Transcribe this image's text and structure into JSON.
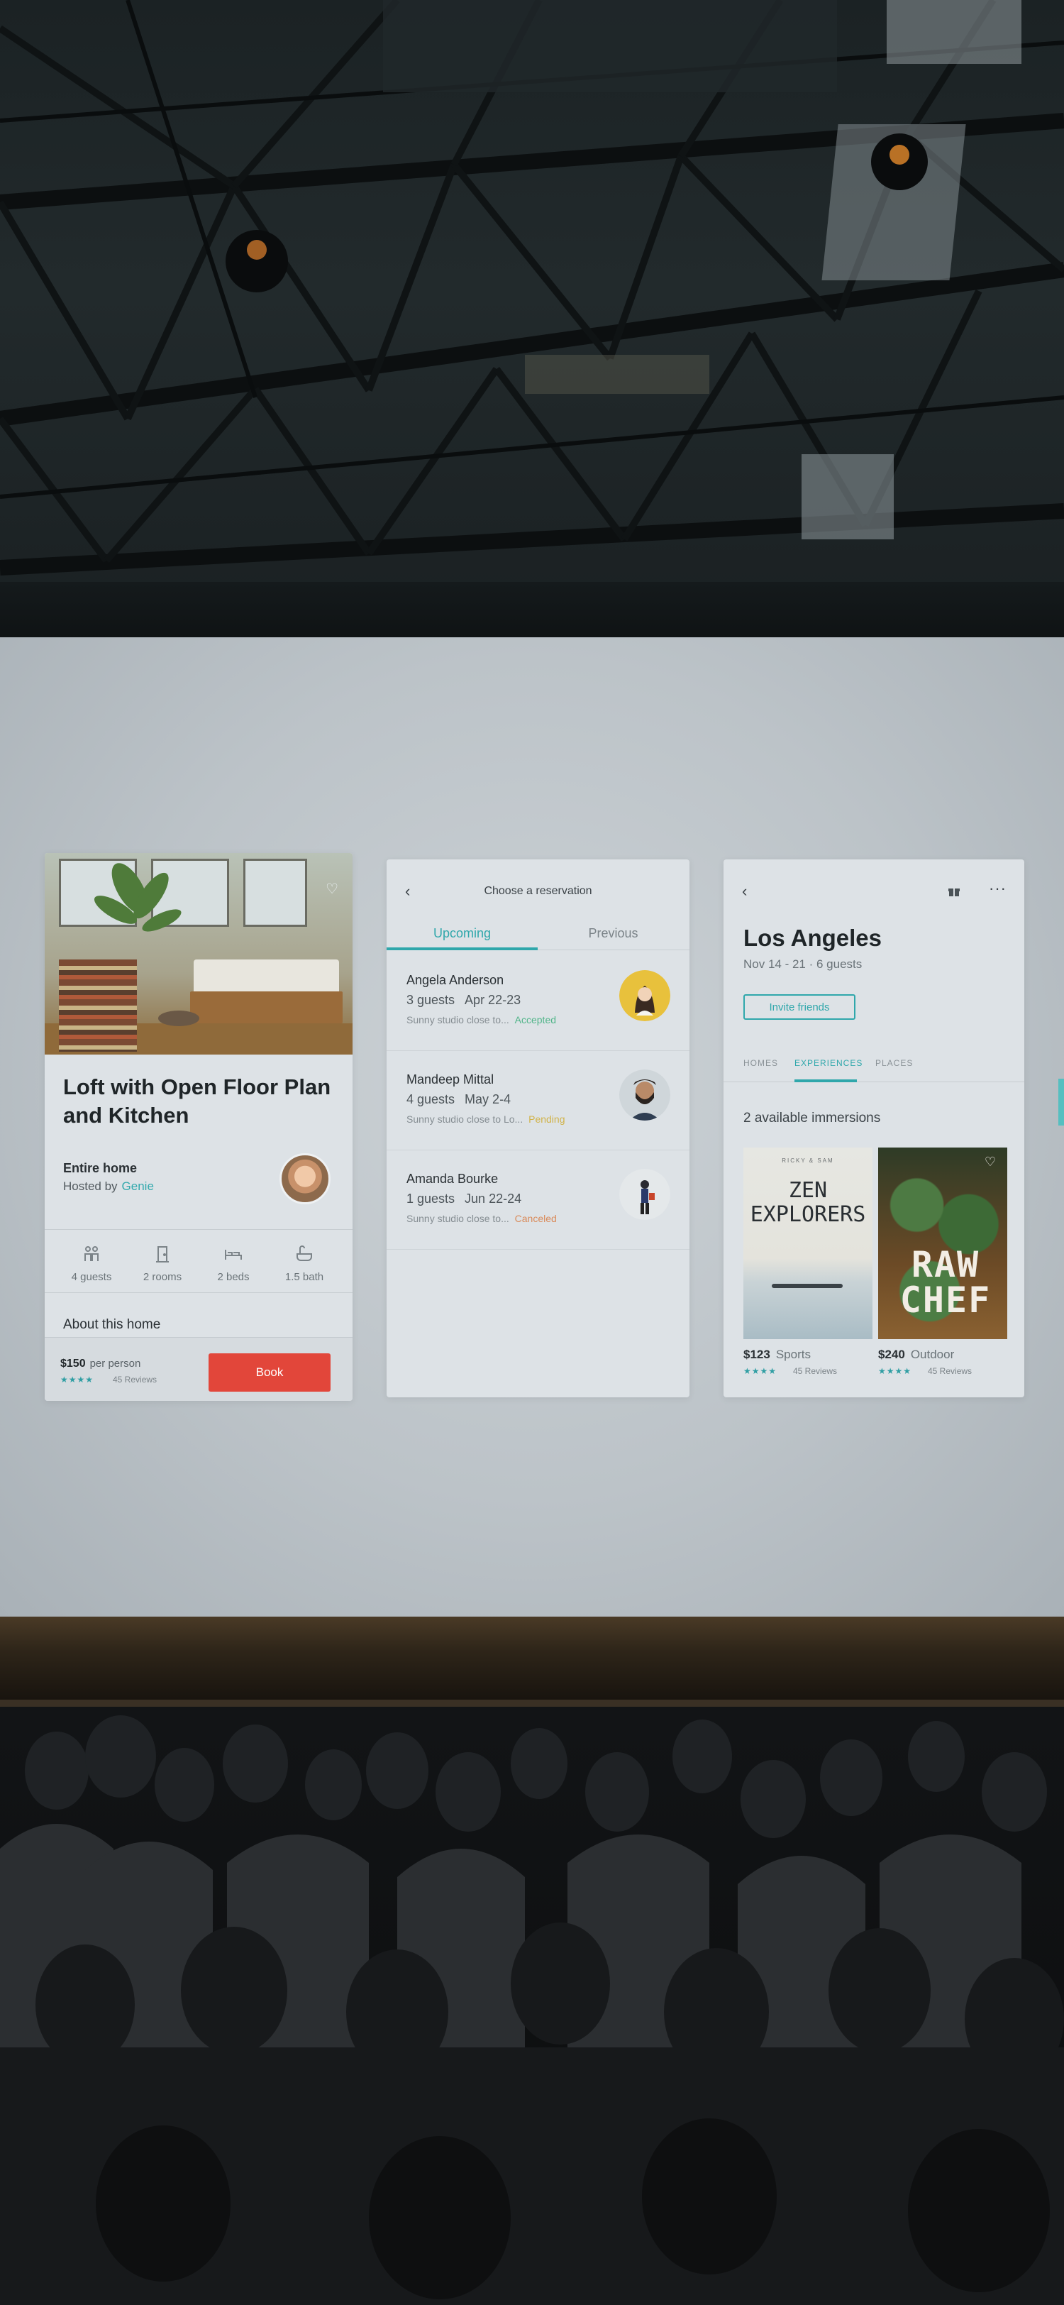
{
  "listing": {
    "title": "Loft with Open Floor Plan and Kitchen",
    "type": "Entire home",
    "hosted_by_label": "Hosted by",
    "host_name": "Genie",
    "amenities": [
      {
        "icon": "guests-icon",
        "label": "4 guests"
      },
      {
        "icon": "door-icon",
        "label": "2 rooms"
      },
      {
        "icon": "bed-icon",
        "label": "2 beds"
      },
      {
        "icon": "bath-icon",
        "label": "1.5 bath"
      }
    ],
    "about_label": "About this home",
    "price": "$150",
    "price_unit": "per person",
    "stars": "★★★★",
    "reviews": "45 Reviews",
    "book_label": "Book",
    "accent_color": "#e2463a"
  },
  "reservations": {
    "title": "Choose a reservation",
    "tabs": [
      "Upcoming",
      "Previous"
    ],
    "rows": [
      {
        "name": "Angela Anderson",
        "guests": "3 guests",
        "dates": "Apr 22-23",
        "desc": "Sunny studio close to... ",
        "status": "Accepted",
        "status_color": "#52b58a"
      },
      {
        "name": "Mandeep Mittal",
        "guests": "4 guests",
        "dates": "May 2-4",
        "desc": "Sunny studio close to Lo... ",
        "status": "Pending",
        "status_color": "#d1b34a"
      },
      {
        "name": "Amanda Bourke",
        "guests": "1 guests",
        "dates": "Jun 22-24",
        "desc": "Sunny studio close to... ",
        "status": "Canceled",
        "status_color": "#d98a5a"
      }
    ],
    "accent_color": "#2fa7ab"
  },
  "destination": {
    "city": "Los Angeles",
    "dates": "Nov 14 - 21 · 6 guests",
    "invite_label": "Invite friends",
    "tabs": [
      "HOMES",
      "EXPERIENCES",
      "PLACES"
    ],
    "immersions_label": "2 available immersions",
    "experiences": [
      {
        "kicker": "RICKY & SAM",
        "title": "ZEN EXPLORERS",
        "price": "$123",
        "category": "Sports",
        "stars": "★★★★",
        "reviews": "45 Reviews"
      },
      {
        "title": "RAW CHEF",
        "price": "$240",
        "category": "Outdoor",
        "stars": "★★★★",
        "reviews": "45 Reviews"
      }
    ]
  }
}
